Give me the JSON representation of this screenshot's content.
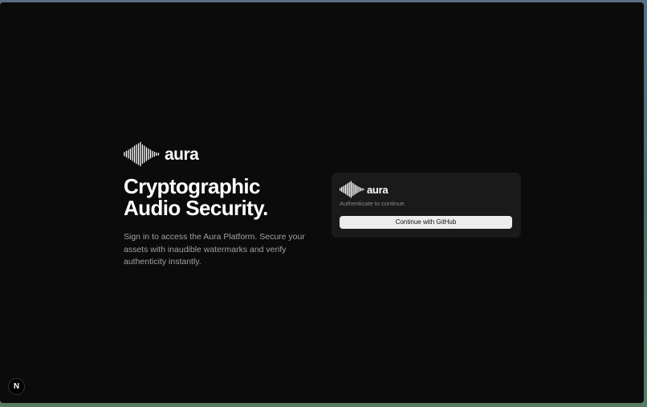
{
  "hero": {
    "brand_name": "aura",
    "logo_icon": "waveform-icon",
    "headline": "Cryptographic\nAudio Security.",
    "description": "Sign in to access the Aura Platform. Secure your assets with inaudible watermarks and verify authenticity instantly."
  },
  "auth_card": {
    "brand_name": "aura",
    "logo_icon": "waveform-icon",
    "caption": "Authenticate to continue.",
    "github_button_label": "Continue with GitHub"
  },
  "dev_badge": {
    "label": "N",
    "icon": "nextjs-icon"
  },
  "colors": {
    "background": "#0b0b0b",
    "card": "#1a1a1a",
    "button": "#ececec",
    "text_primary": "#ffffff",
    "text_muted": "#a1a1a1"
  }
}
